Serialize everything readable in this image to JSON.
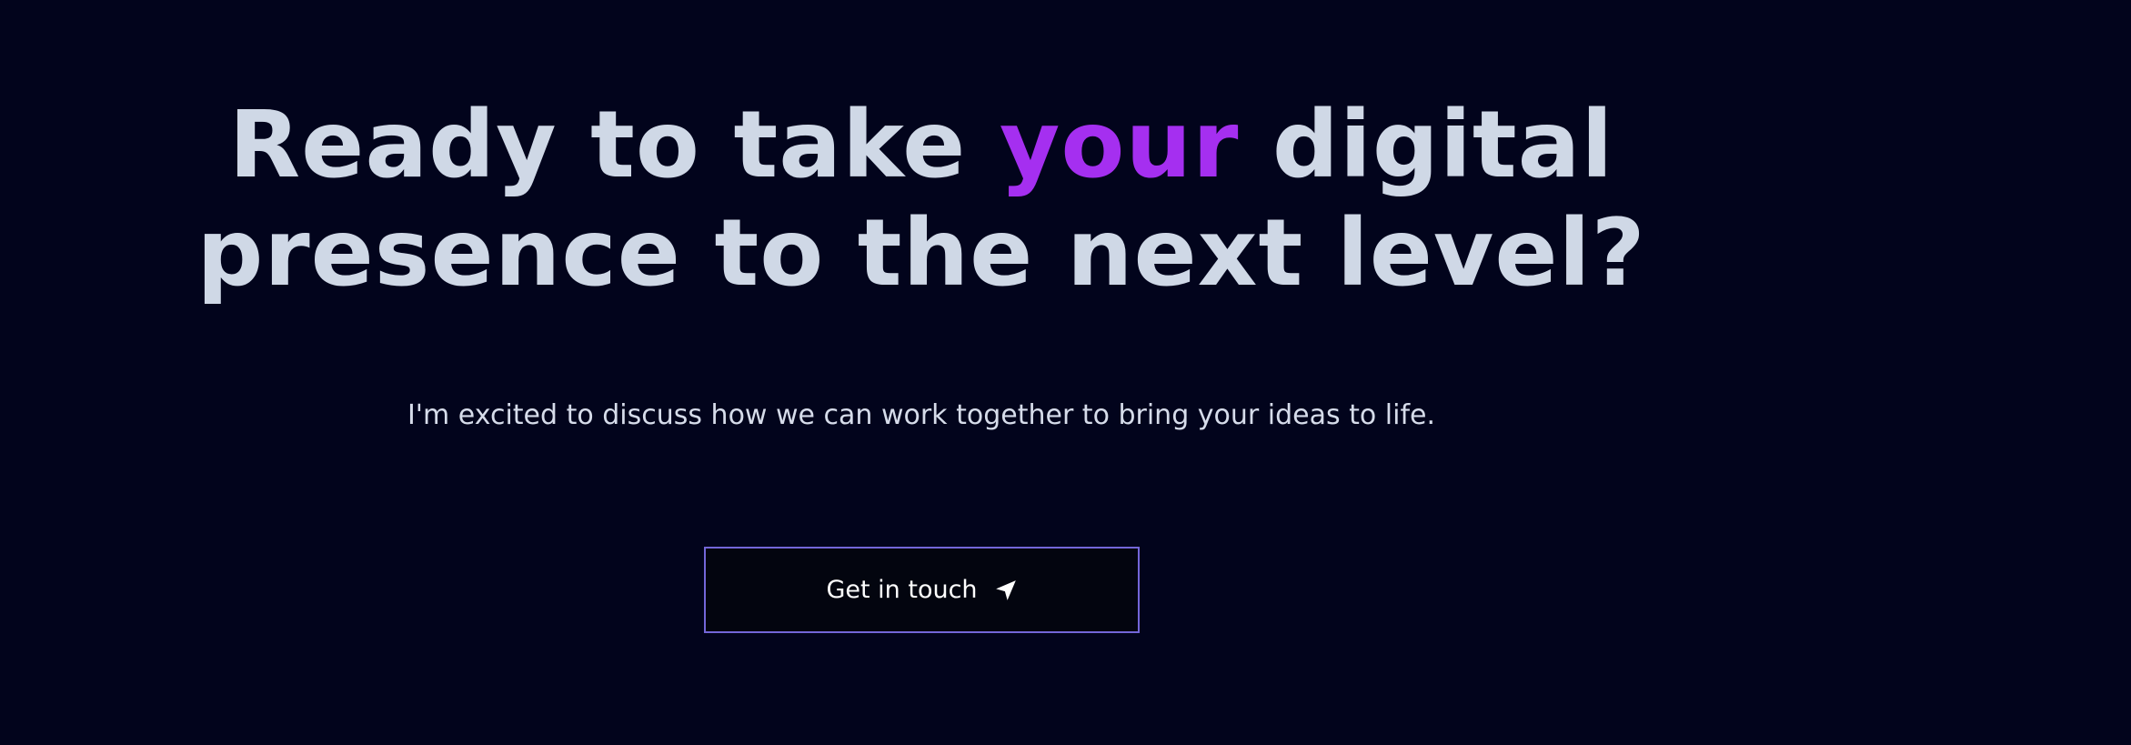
{
  "headline": {
    "line1_before": "Ready to take ",
    "line1_accent": "your",
    "line1_after": " digital",
    "line2": "presence to the next level?",
    "accent_color": "#a52ff0"
  },
  "subtitle": "I'm excited to discuss how we can work together to bring your ideas to life.",
  "cta": {
    "label": "Get in touch",
    "icon": "send-arrow-icon",
    "border_color": "#7366d8"
  },
  "colors": {
    "background": "#02041c",
    "text": "#cfd8e6"
  }
}
